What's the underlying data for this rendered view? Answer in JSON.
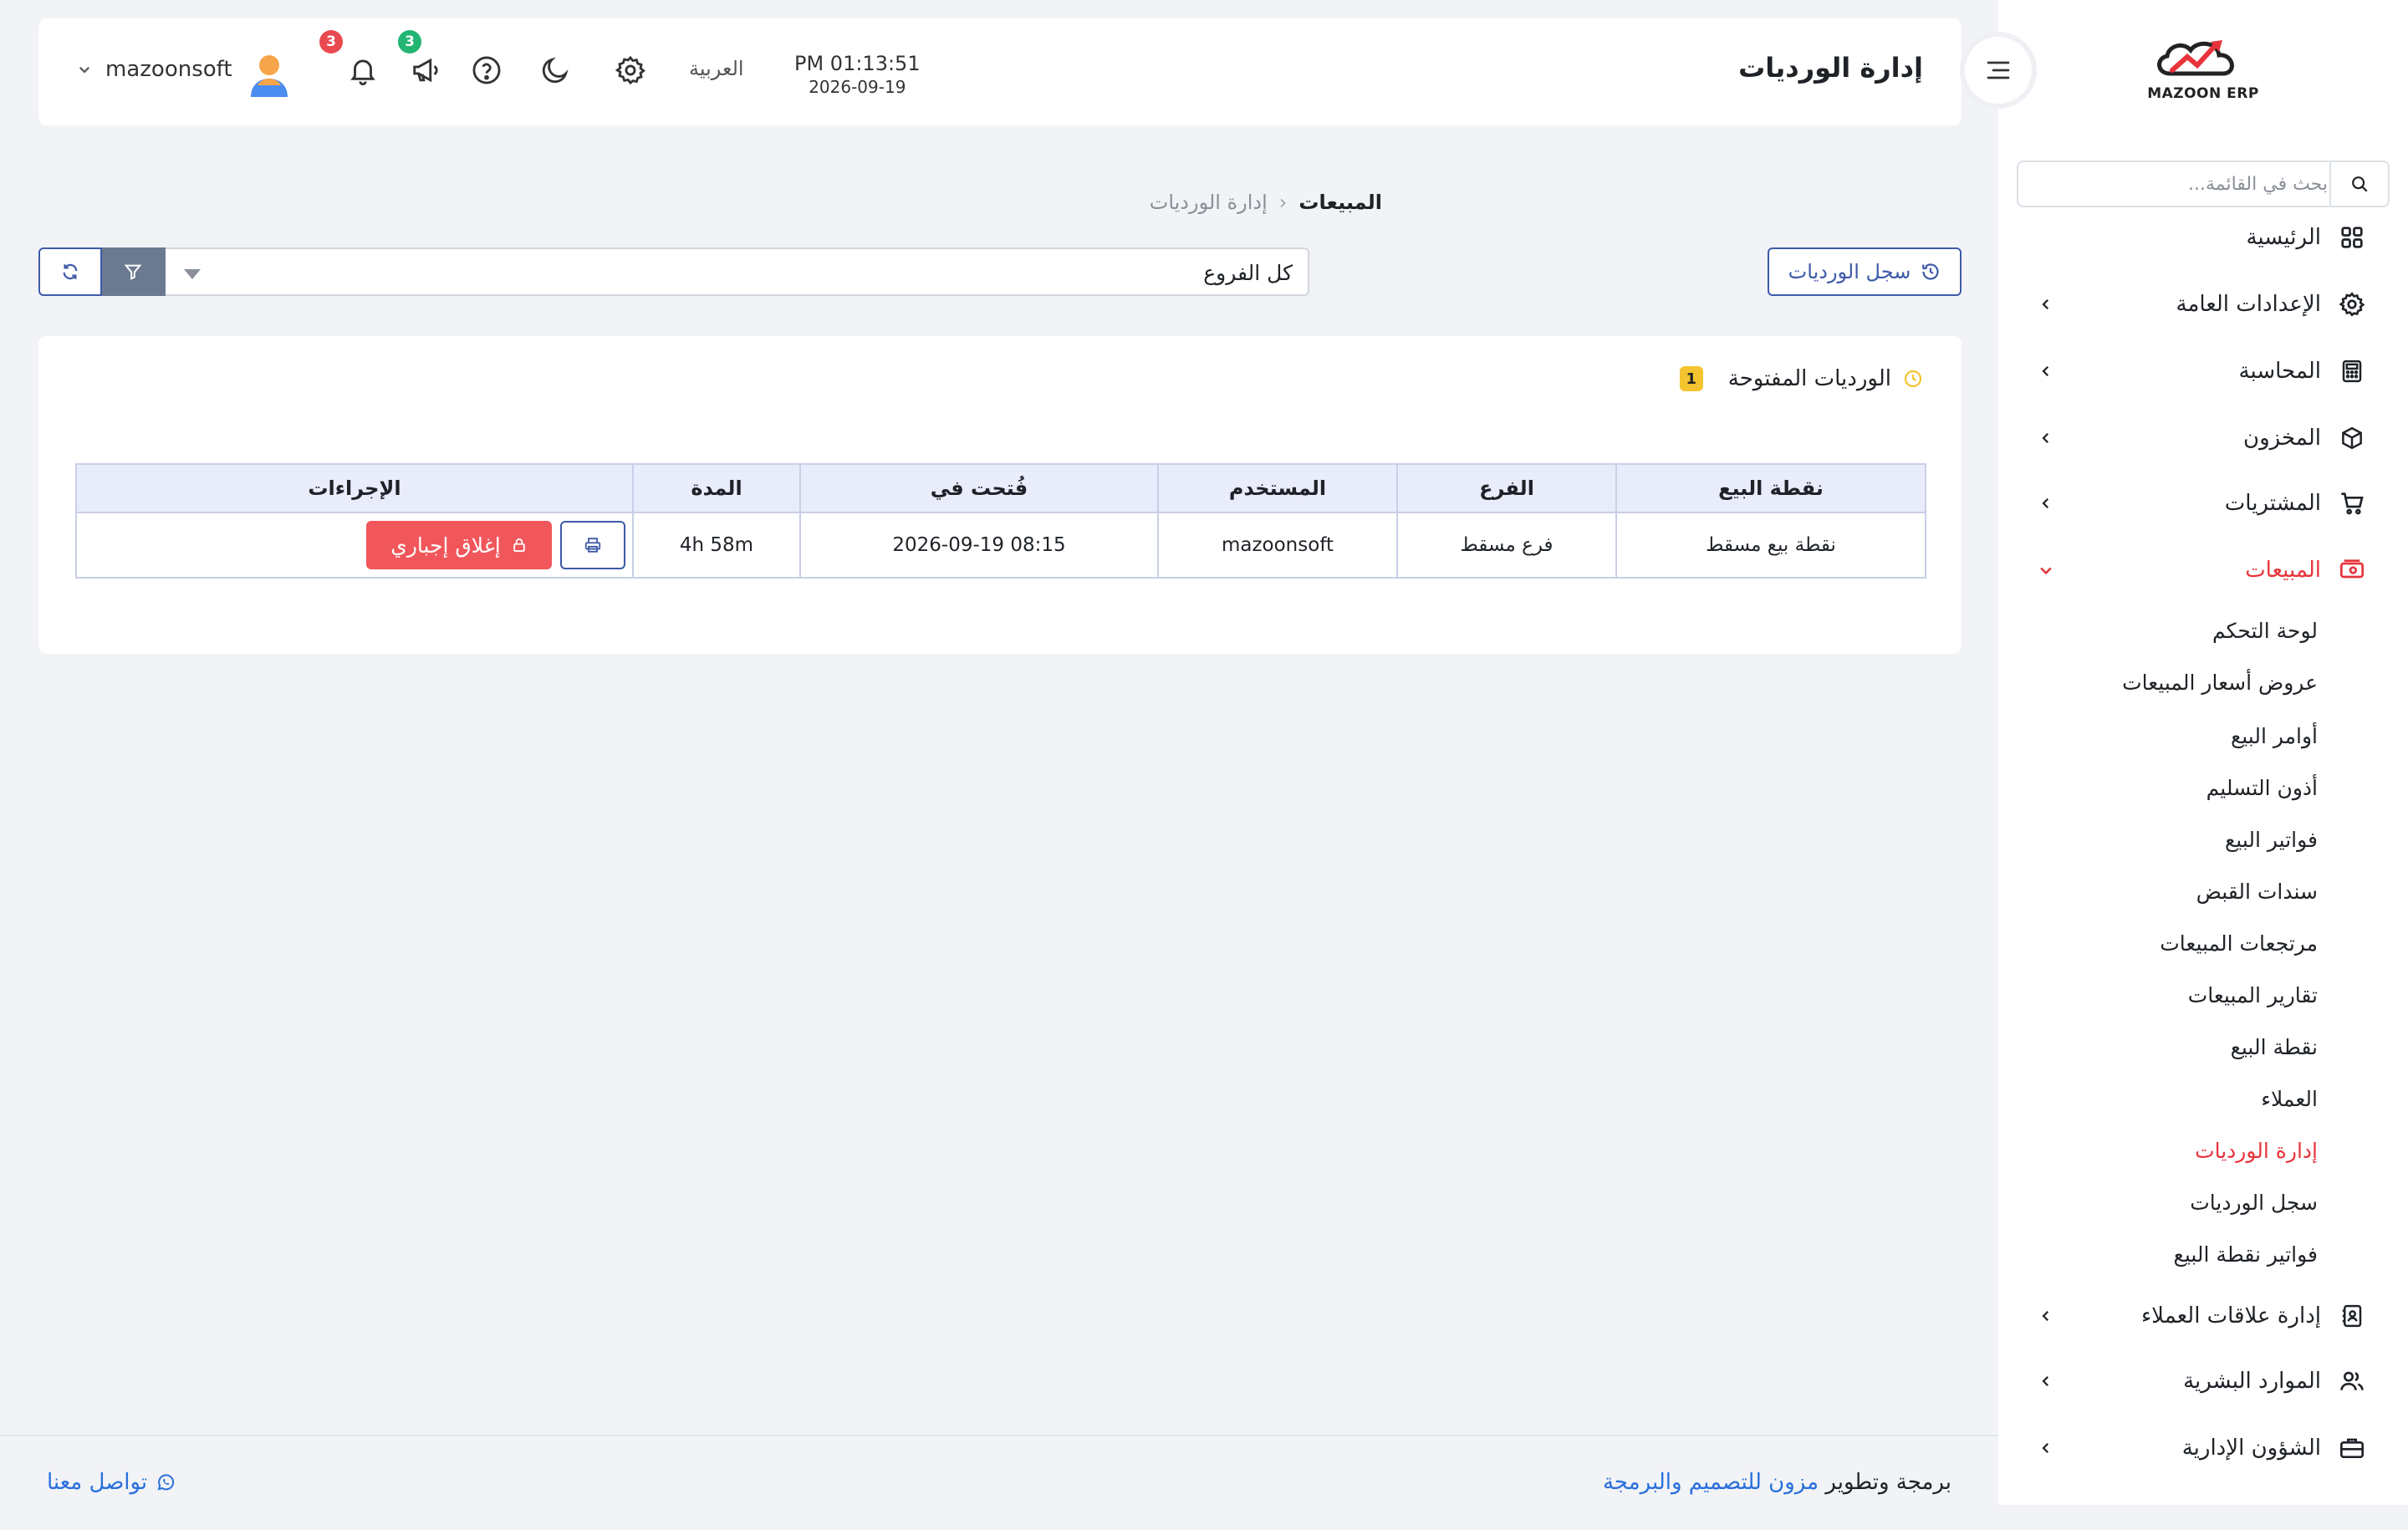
{
  "app": {
    "logo_text": "MAZOON ERP"
  },
  "header": {
    "title": "إدارة الورديات",
    "time": "PM 01:13:51",
    "date": "2026-09-19",
    "language": "العربية",
    "notifications_count": "3",
    "announcements_count": "3",
    "user_name": "mazoonsoft",
    "icons": [
      "menu-collapse-icon",
      "gear-icon",
      "moon-icon",
      "help-icon",
      "megaphone-icon",
      "bell-icon",
      "avatar",
      "chevron-down-icon"
    ]
  },
  "sidebar": {
    "search_placeholder": "بحث في القائمة...",
    "items": [
      {
        "label": "الرئيسية",
        "icon": "grid-icon",
        "has_children": false
      },
      {
        "label": "الإعدادات العامة",
        "icon": "gear-icon",
        "has_children": true
      },
      {
        "label": "المحاسبة",
        "icon": "calculator-icon",
        "has_children": true
      },
      {
        "label": "المخزون",
        "icon": "box-icon",
        "has_children": true
      },
      {
        "label": "المشتريات",
        "icon": "cart-icon",
        "has_children": true
      },
      {
        "label": "المبيعات",
        "icon": "sales-icon",
        "has_children": true,
        "expanded": true
      },
      {
        "label": "إدارة علاقات العملاء",
        "icon": "contacts-icon",
        "has_children": true
      },
      {
        "label": "الموارد البشرية",
        "icon": "users-icon",
        "has_children": true
      },
      {
        "label": "الشؤون الإدارية",
        "icon": "briefcase-icon",
        "has_children": true
      }
    ],
    "sales_sub": [
      "لوحة التحكم",
      "عروض أسعار المبيعات",
      "أوامر البيع",
      "أذون التسليم",
      "فواتير البيع",
      "سندات القبض",
      "مرتجعات المبيعات",
      "تقارير المبيعات",
      "نقطة البيع",
      "العملاء",
      "إدارة الورديات",
      "سجل الورديات",
      "فواتير نقطة البيع"
    ],
    "active_sub_index": 10
  },
  "breadcrumb": {
    "section": "المبيعات",
    "page": "إدارة الورديات",
    "separator": "‹"
  },
  "toolbar": {
    "log_button": "سجل الورديات",
    "branch_value": "كل الفروع"
  },
  "card": {
    "title": "الورديات المفتوحة",
    "count": "1",
    "columns": [
      "نقطة البيع",
      "الفرع",
      "المستخدم",
      "فُتحت في",
      "المدة",
      "الإجراءات"
    ],
    "rows": [
      {
        "pos": "نقطة بيع مسقط",
        "branch": "فرع مسقط",
        "user": "mazoonsoft",
        "opened_at": "2026-09-19 08:15",
        "duration": "4h 58m",
        "force_close_label": "إغلاق إجباري"
      }
    ]
  },
  "footer": {
    "credit_prefix": "برمجة وتطوير",
    "credit_link": "مزون للتصميم والبرمجة",
    "contact": "تواصل معنا"
  },
  "colors": {
    "accent": "#3e5aa8",
    "active": "#e8333b",
    "danger": "#f0565a",
    "badge_red": "#e84a4f",
    "badge_green": "#22b573",
    "count_badge": "#f4c430"
  }
}
